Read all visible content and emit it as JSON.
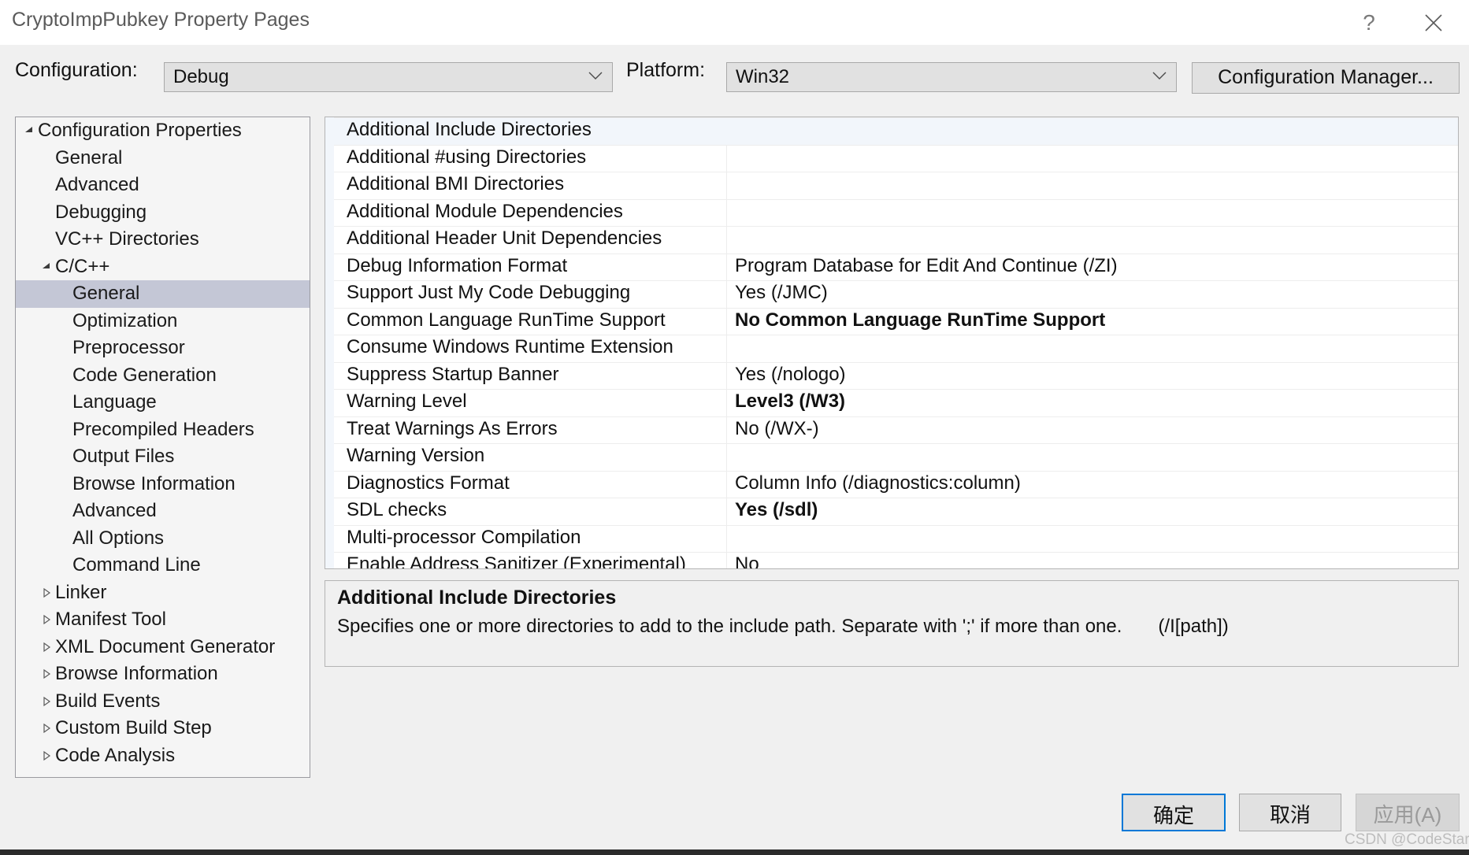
{
  "window": {
    "title": "CryptoImpPubkey Property Pages",
    "help_icon": "question-mark-icon",
    "close_icon": "close-x-icon"
  },
  "configbar": {
    "configuration_label": "Configuration:",
    "configuration_value": "Debug",
    "platform_label": "Platform:",
    "platform_value": "Win32",
    "configuration_manager_label": "Configuration Manager...",
    "chevron_icon": "chevron-down-icon"
  },
  "tree": {
    "expanded_icon": "triangle-expanded-icon",
    "collapsed_icon": "triangle-collapsed-icon",
    "items": [
      {
        "label": "Configuration Properties",
        "level": 0,
        "state": "expanded",
        "selected": false
      },
      {
        "label": "General",
        "level": 1,
        "state": "leaf",
        "selected": false
      },
      {
        "label": "Advanced",
        "level": 1,
        "state": "leaf",
        "selected": false
      },
      {
        "label": "Debugging",
        "level": 1,
        "state": "leaf",
        "selected": false
      },
      {
        "label": "VC++ Directories",
        "level": 1,
        "state": "leaf",
        "selected": false
      },
      {
        "label": "C/C++",
        "level": 1,
        "state": "expanded",
        "selected": false
      },
      {
        "label": "General",
        "level": 2,
        "state": "leaf",
        "selected": true
      },
      {
        "label": "Optimization",
        "level": 2,
        "state": "leaf",
        "selected": false
      },
      {
        "label": "Preprocessor",
        "level": 2,
        "state": "leaf",
        "selected": false
      },
      {
        "label": "Code Generation",
        "level": 2,
        "state": "leaf",
        "selected": false
      },
      {
        "label": "Language",
        "level": 2,
        "state": "leaf",
        "selected": false
      },
      {
        "label": "Precompiled Headers",
        "level": 2,
        "state": "leaf",
        "selected": false
      },
      {
        "label": "Output Files",
        "level": 2,
        "state": "leaf",
        "selected": false
      },
      {
        "label": "Browse Information",
        "level": 2,
        "state": "leaf",
        "selected": false
      },
      {
        "label": "Advanced",
        "level": 2,
        "state": "leaf",
        "selected": false
      },
      {
        "label": "All Options",
        "level": 2,
        "state": "leaf",
        "selected": false
      },
      {
        "label": "Command Line",
        "level": 2,
        "state": "leaf",
        "selected": false
      },
      {
        "label": "Linker",
        "level": 1,
        "state": "collapsed",
        "selected": false
      },
      {
        "label": "Manifest Tool",
        "level": 1,
        "state": "collapsed",
        "selected": false
      },
      {
        "label": "XML Document Generator",
        "level": 1,
        "state": "collapsed",
        "selected": false
      },
      {
        "label": "Browse Information",
        "level": 1,
        "state": "collapsed",
        "selected": false
      },
      {
        "label": "Build Events",
        "level": 1,
        "state": "collapsed",
        "selected": false
      },
      {
        "label": "Custom Build Step",
        "level": 1,
        "state": "collapsed",
        "selected": false
      },
      {
        "label": "Code Analysis",
        "level": 1,
        "state": "collapsed",
        "selected": false
      }
    ]
  },
  "grid": {
    "rows": [
      {
        "name": "Additional Include Directories",
        "value": "",
        "bold": false,
        "selected": true
      },
      {
        "name": "Additional #using Directories",
        "value": "",
        "bold": false,
        "selected": false
      },
      {
        "name": "Additional BMI Directories",
        "value": "",
        "bold": false,
        "selected": false
      },
      {
        "name": "Additional Module Dependencies",
        "value": "",
        "bold": false,
        "selected": false
      },
      {
        "name": "Additional Header Unit Dependencies",
        "value": "",
        "bold": false,
        "selected": false
      },
      {
        "name": "Debug Information Format",
        "value": "Program Database for Edit And Continue (/ZI)",
        "bold": false,
        "selected": false
      },
      {
        "name": "Support Just My Code Debugging",
        "value": "Yes (/JMC)",
        "bold": false,
        "selected": false
      },
      {
        "name": "Common Language RunTime Support",
        "value": "No Common Language RunTime Support",
        "bold": true,
        "selected": false
      },
      {
        "name": "Consume Windows Runtime Extension",
        "value": "",
        "bold": false,
        "selected": false
      },
      {
        "name": "Suppress Startup Banner",
        "value": "Yes (/nologo)",
        "bold": false,
        "selected": false
      },
      {
        "name": "Warning Level",
        "value": "Level3 (/W3)",
        "bold": true,
        "selected": false
      },
      {
        "name": "Treat Warnings As Errors",
        "value": "No (/WX-)",
        "bold": false,
        "selected": false
      },
      {
        "name": "Warning Version",
        "value": "",
        "bold": false,
        "selected": false
      },
      {
        "name": "Diagnostics Format",
        "value": "Column Info (/diagnostics:column)",
        "bold": false,
        "selected": false
      },
      {
        "name": "SDL checks",
        "value": "Yes (/sdl)",
        "bold": true,
        "selected": false
      },
      {
        "name": "Multi-processor Compilation",
        "value": "",
        "bold": false,
        "selected": false
      },
      {
        "name": "Enable Address Sanitizer (Experimental)",
        "value": "No",
        "bold": false,
        "selected": false
      }
    ]
  },
  "description": {
    "title": "Additional Include Directories",
    "text": "Specifies one or more directories to add to the include path. Separate with ';' if more than one.",
    "switch": "(/I[path])"
  },
  "footer": {
    "ok_label": "确定",
    "cancel_label": "取消",
    "apply_label": "应用(A)",
    "apply_disabled": true,
    "watermark": "CSDN @CodeStarr"
  },
  "colors": {
    "accent": "#0078d7",
    "selection_tree": "#c4c7d6",
    "selection_grid": "#f2f6fb",
    "dialog_bg": "#f0f0f0"
  }
}
